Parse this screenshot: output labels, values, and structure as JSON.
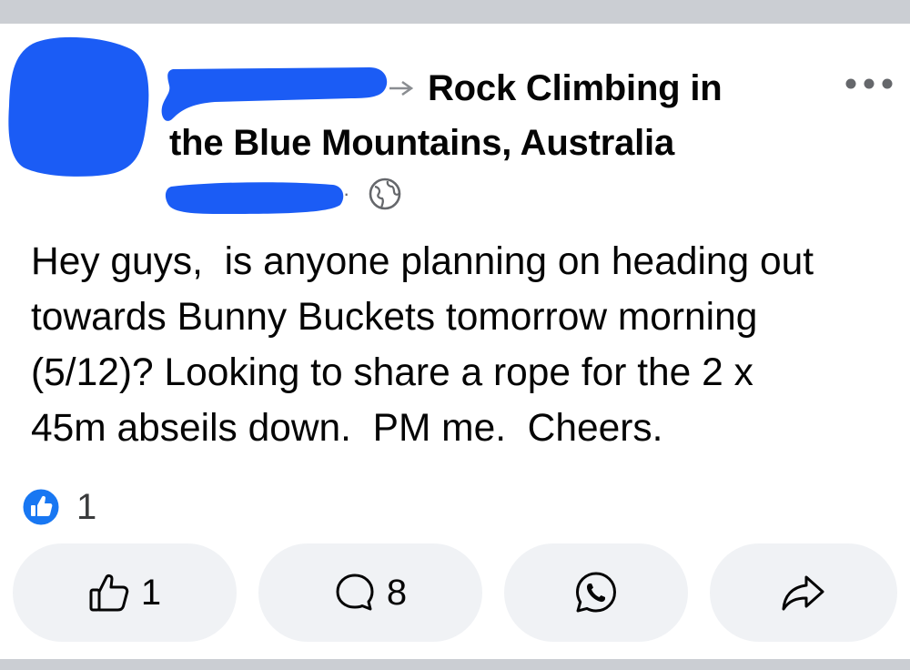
{
  "post": {
    "group_name_line1": "Rock Climbing in",
    "group_name_line2": "the Blue Mountains, Australia",
    "time_separator": "·",
    "privacy_icon": "globe-icon",
    "more_icon": "more-horizontal-icon",
    "body_lines": [
      "Hey guys,  is anyone planning on heading out",
      "towards Bunny Buckets tomorrow morning",
      "(5/12)? Looking to share a rope for the 2 x",
      "45m abseils down.  PM me.  Cheers."
    ],
    "reactions": {
      "icon": "like-reaction-icon",
      "count": "1"
    }
  },
  "actions": {
    "like": {
      "icon": "thumbs-up-icon",
      "count": "1"
    },
    "comment": {
      "icon": "comment-icon",
      "count": "8"
    },
    "whatsapp": {
      "icon": "whatsapp-icon"
    },
    "share": {
      "icon": "share-icon"
    }
  },
  "colors": {
    "redaction": "#1b5cf5",
    "like_blue": "#1877f2",
    "button_bg": "#f0f2f5",
    "frame_band": "#cbced3",
    "text": "#050505",
    "muted": "#65676b"
  }
}
